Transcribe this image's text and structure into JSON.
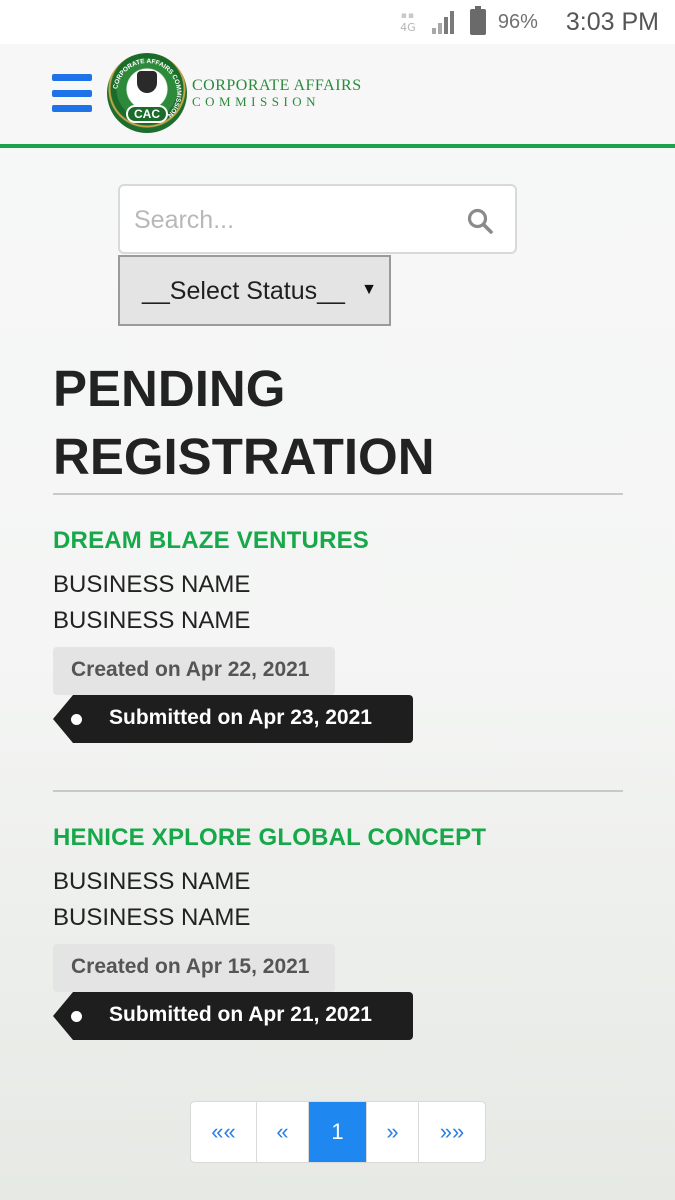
{
  "status_bar": {
    "network": "4G",
    "battery_percent": "96%",
    "time": "3:03 PM"
  },
  "header": {
    "logo_badge": "CAC",
    "logo_title_line1": "CORPORATE AFFAIRS",
    "logo_title_line2": "COMMISSION",
    "logo_ring_text": "CORPORATE AFFAIRS COMMISSION",
    "menu_icon": "hamburger-icon",
    "accent_color": "#1aa34a",
    "menu_color": "#1e73e8"
  },
  "search": {
    "placeholder": "Search...",
    "value": "",
    "icon": "search-icon"
  },
  "status_filter": {
    "selected": "__Select Status__"
  },
  "page": {
    "title_line1": "PENDING",
    "title_line2": "REGISTRATION"
  },
  "registrations": [
    {
      "name": "DREAM BLAZE VENTURES",
      "type_line1": "BUSINESS NAME",
      "type_line2": "BUSINESS NAME",
      "created": "Created on Apr 22, 2021",
      "submitted": "Submitted on Apr 23, 2021"
    },
    {
      "name": "HENICE XPLORE GLOBAL CONCEPT",
      "type_line1": "BUSINESS NAME",
      "type_line2": "BUSINESS NAME",
      "created": "Created on Apr 15, 2021",
      "submitted": "Submitted on Apr 21, 2021"
    }
  ],
  "pagination": {
    "first": "««",
    "prev": "«",
    "current": "1",
    "next": "»",
    "last": "»»"
  }
}
